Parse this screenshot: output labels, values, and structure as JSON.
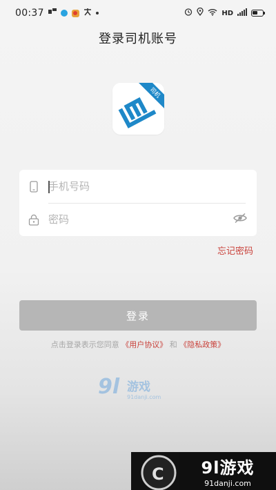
{
  "status_bar": {
    "time": "00:37",
    "network": "HD",
    "icons": [
      "notification-icon",
      "bluetooth-icon",
      "app-icon",
      "alarm-icon",
      "location-icon",
      "wifi-icon",
      "signal-icon",
      "battery-icon"
    ]
  },
  "page": {
    "title": "登录司机账号"
  },
  "logo": {
    "badge": "司机",
    "accent": "#1e88c8"
  },
  "form": {
    "phone_placeholder": "手机号码",
    "password_placeholder": "密码"
  },
  "forgot_password": "忘记密码",
  "login_button": "登录",
  "agreement": {
    "prefix": "点击登录表示您同意",
    "user_agreement": "《用户协议》",
    "conjunction": "和",
    "privacy_policy": "《隐私政策》"
  },
  "watermark": {
    "brand": "9l游戏",
    "url": "91danji.com"
  },
  "colors": {
    "link": "#c9423b",
    "button_disabled": "#b6b6b6"
  }
}
